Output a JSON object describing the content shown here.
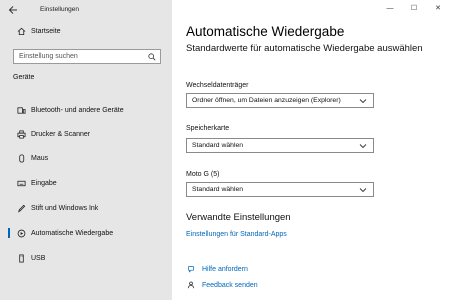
{
  "app": {
    "title": "Einstellungen"
  },
  "sidebar": {
    "home": "Startseite",
    "search_placeholder": "Einstellung suchen",
    "section": "Geräte",
    "items": [
      {
        "label": "Bluetooth- und andere Geräte",
        "icon": "bluetooth-icon"
      },
      {
        "label": "Drucker & Scanner",
        "icon": "printer-icon"
      },
      {
        "label": "Maus",
        "icon": "mouse-icon"
      },
      {
        "label": "Eingabe",
        "icon": "keyboard-icon"
      },
      {
        "label": "Stift und Windows Ink",
        "icon": "pen-icon"
      },
      {
        "label": "Automatische Wiedergabe",
        "icon": "autoplay-icon",
        "active": true
      },
      {
        "label": "USB",
        "icon": "usb-icon"
      }
    ]
  },
  "window_controls": {
    "minimize": "—",
    "maximize": "☐",
    "close": "✕"
  },
  "main": {
    "title": "Automatische Wiedergabe",
    "subtitle": "Standardwerte für automatische Wiedergabe auswählen",
    "fields": [
      {
        "label": "Wechseldatenträger",
        "value": "Ordner öffnen, um Dateien anzuzeigen (Explorer)"
      },
      {
        "label": "Speicherkarte",
        "value": "Standard wählen"
      },
      {
        "label": "Moto G (5)",
        "value": "Standard wählen"
      }
    ],
    "related": {
      "heading": "Verwandte Einstellungen",
      "link": "Einstellungen für Standard-Apps"
    },
    "help": [
      {
        "label": "Hilfe anfordern",
        "icon": "help-icon"
      },
      {
        "label": "Feedback senden",
        "icon": "feedback-icon"
      }
    ]
  },
  "colors": {
    "accent": "#0067b8",
    "sidebar_bg": "#e6e6e6"
  }
}
